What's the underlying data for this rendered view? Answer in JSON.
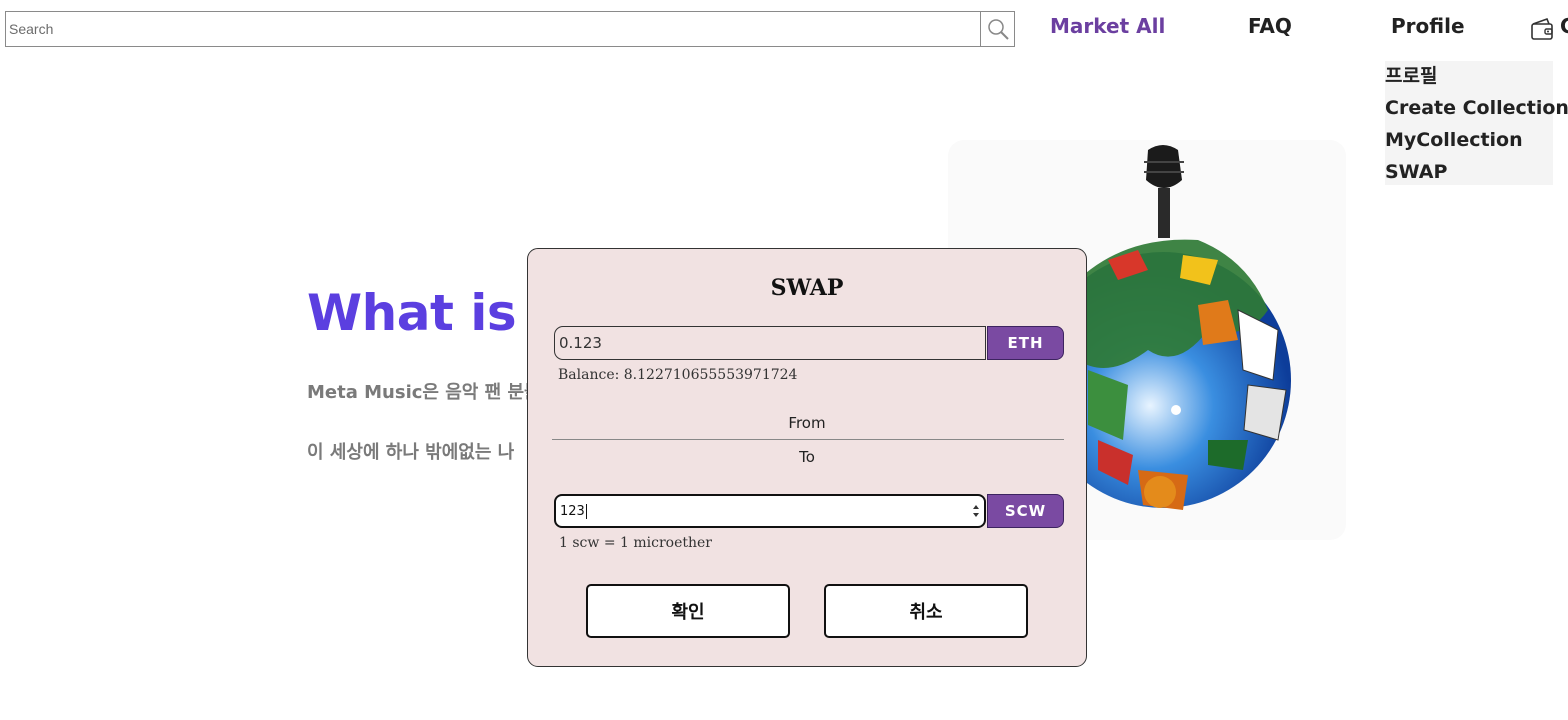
{
  "header": {
    "search_placeholder": "Search",
    "nav": {
      "market_all": "Market All",
      "faq": "FAQ",
      "profile": "Profile"
    },
    "wallet_icon": "wallet-icon",
    "wallet_text_clipped": "C",
    "accent_color": "#6b3fa0"
  },
  "profile_menu": {
    "items": [
      {
        "label": "프로필"
      },
      {
        "label": "Create Collection"
      },
      {
        "label": "MyCollection"
      },
      {
        "label": "SWAP"
      }
    ]
  },
  "hero": {
    "title_visible": "What is M",
    "line1_visible": "Meta Music은 음악 팬 분들",
    "line2_visible": "이 세상에 하나 밖에없는 나",
    "title_color": "#5b3fe0",
    "image": "globe-with-guitar-illustration"
  },
  "swap_modal": {
    "title": "SWAP",
    "from_amount": "0.123",
    "from_token": "ETH",
    "balance": "Balance: 8.122710655553971724",
    "from_label": "From",
    "to_label": "To",
    "to_amount": "123",
    "to_token": "SCW",
    "rate": "1 scw = 1 microether",
    "confirm_label": "확인",
    "cancel_label": "취소",
    "background_color": "#f1e2e2",
    "token_button_color": "#7a4aa2"
  }
}
